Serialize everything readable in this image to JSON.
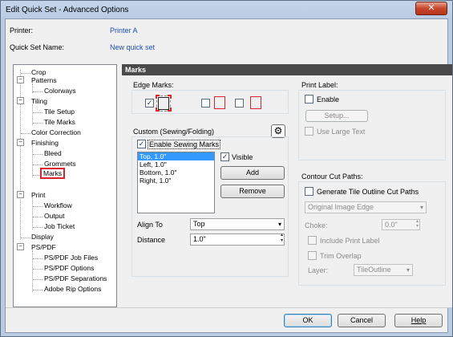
{
  "window": {
    "title": "Edit Quick Set - Advanced Options",
    "close_glyph": "✕"
  },
  "info": {
    "printer_label": "Printer:",
    "printer_value": "Printer A",
    "quickset_label": "Quick Set Name:",
    "quickset_value": "New quick set"
  },
  "tree": {
    "items": [
      {
        "label": "Crop"
      },
      {
        "label": "Patterns"
      },
      {
        "label": "Colorways"
      },
      {
        "label": "Tiling"
      },
      {
        "label": "Tile Setup"
      },
      {
        "label": "Tile Marks"
      },
      {
        "label": "Color Correction"
      },
      {
        "label": "Finishing"
      },
      {
        "label": "Bleed"
      },
      {
        "label": "Grommets"
      },
      {
        "label": "Marks"
      },
      {
        "label": "Print"
      },
      {
        "label": "Workflow"
      },
      {
        "label": "Output"
      },
      {
        "label": "Job Ticket"
      },
      {
        "label": "Display"
      },
      {
        "label": "PS/PDF"
      },
      {
        "label": "PS/PDF Job Files"
      },
      {
        "label": "PS/PDF Options"
      },
      {
        "label": "PS/PDF Separations"
      },
      {
        "label": "Adobe Rip Options"
      }
    ],
    "expanded_glyph": "−"
  },
  "panel": {
    "title": "Marks"
  },
  "edge_marks": {
    "title": "Edge Marks:",
    "check_glyph": "✓"
  },
  "custom": {
    "title": "Custom (Sewing/Folding)",
    "enable_label": "Enable Sewing Marks",
    "visible_label": "Visible",
    "add_label": "Add",
    "remove_label": "Remove",
    "list": [
      "Top, 1.0\"",
      "Left, 1.0\"",
      "Bottom, 1.0\"",
      "Right, 1.0\""
    ],
    "align_label": "Align To",
    "align_value": "Top",
    "distance_label": "Distance",
    "distance_value": "1.0\"",
    "gear_glyph": "⚙",
    "arrow_glyph": "▾",
    "spin_up": "▴",
    "spin_down": "▾"
  },
  "print_label": {
    "title": "Print Label:",
    "enable_label": "Enable",
    "setup_label": "Setup...",
    "large_text_label": "Use Large Text"
  },
  "contour": {
    "title": "Contour Cut Paths:",
    "generate_label": "Generate Tile Outline Cut Paths",
    "edge_value": "Original Image Edge",
    "choke_label": "Choke:",
    "choke_value": "0.0\"",
    "include_label": "Include Print Label",
    "trim_label": "Trim Overlap",
    "layer_label": "Layer:",
    "layer_value": "TileOutline"
  },
  "footer": {
    "ok": "OK",
    "cancel": "Cancel",
    "help": "Help"
  }
}
